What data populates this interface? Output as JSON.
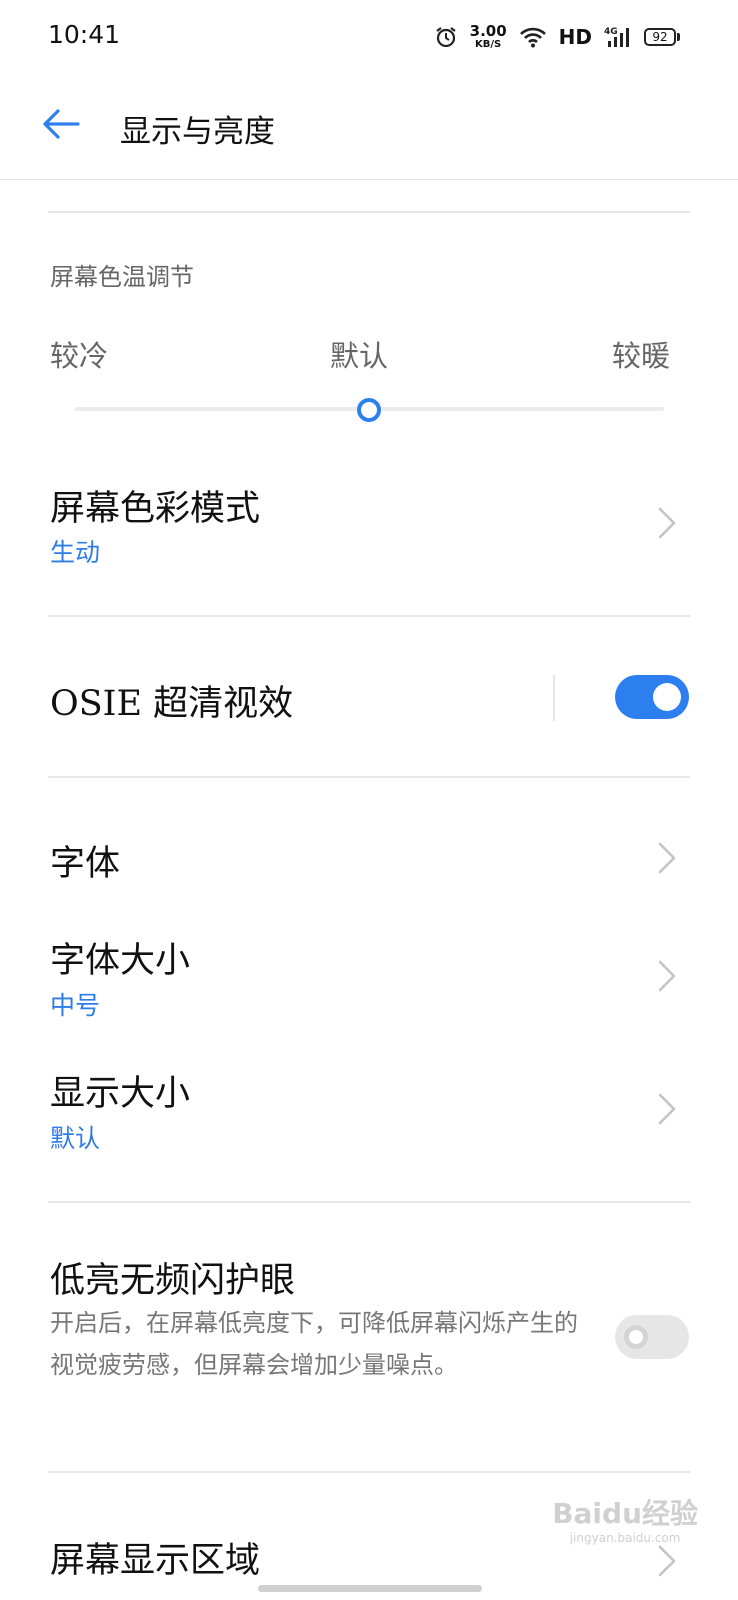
{
  "status_bar": {
    "time": "10:41",
    "net_speed_value": "3.00",
    "net_speed_unit": "KB/S",
    "hd": "HD",
    "network": "4G",
    "battery": "92"
  },
  "header": {
    "title": "显示与亮度"
  },
  "color_temperature": {
    "label": "屏幕色温调节",
    "cooler": "较冷",
    "default": "默认",
    "warmer": "较暖",
    "level": 0.5
  },
  "color_mode": {
    "title": "屏幕色彩模式",
    "value": "生动"
  },
  "osie": {
    "title": "OSIE 超清视效",
    "enabled": true
  },
  "font": {
    "title": "字体"
  },
  "font_size": {
    "title": "字体大小",
    "value": "中号"
  },
  "display_size": {
    "title": "显示大小",
    "value": "默认"
  },
  "flicker_free": {
    "title": "低亮无频闪护眼",
    "description": "开启后，在屏幕低亮度下，可降低屏幕闪烁产生的视觉疲劳感，但屏幕会增加少量噪点。",
    "enabled": false
  },
  "screen_area": {
    "title": "屏幕显示区域"
  },
  "watermark": {
    "brand": "Baidu经验",
    "url": "jingyan.baidu.com"
  },
  "colors": {
    "accent": "#2d7ff0",
    "secondary_text": "#666666"
  }
}
